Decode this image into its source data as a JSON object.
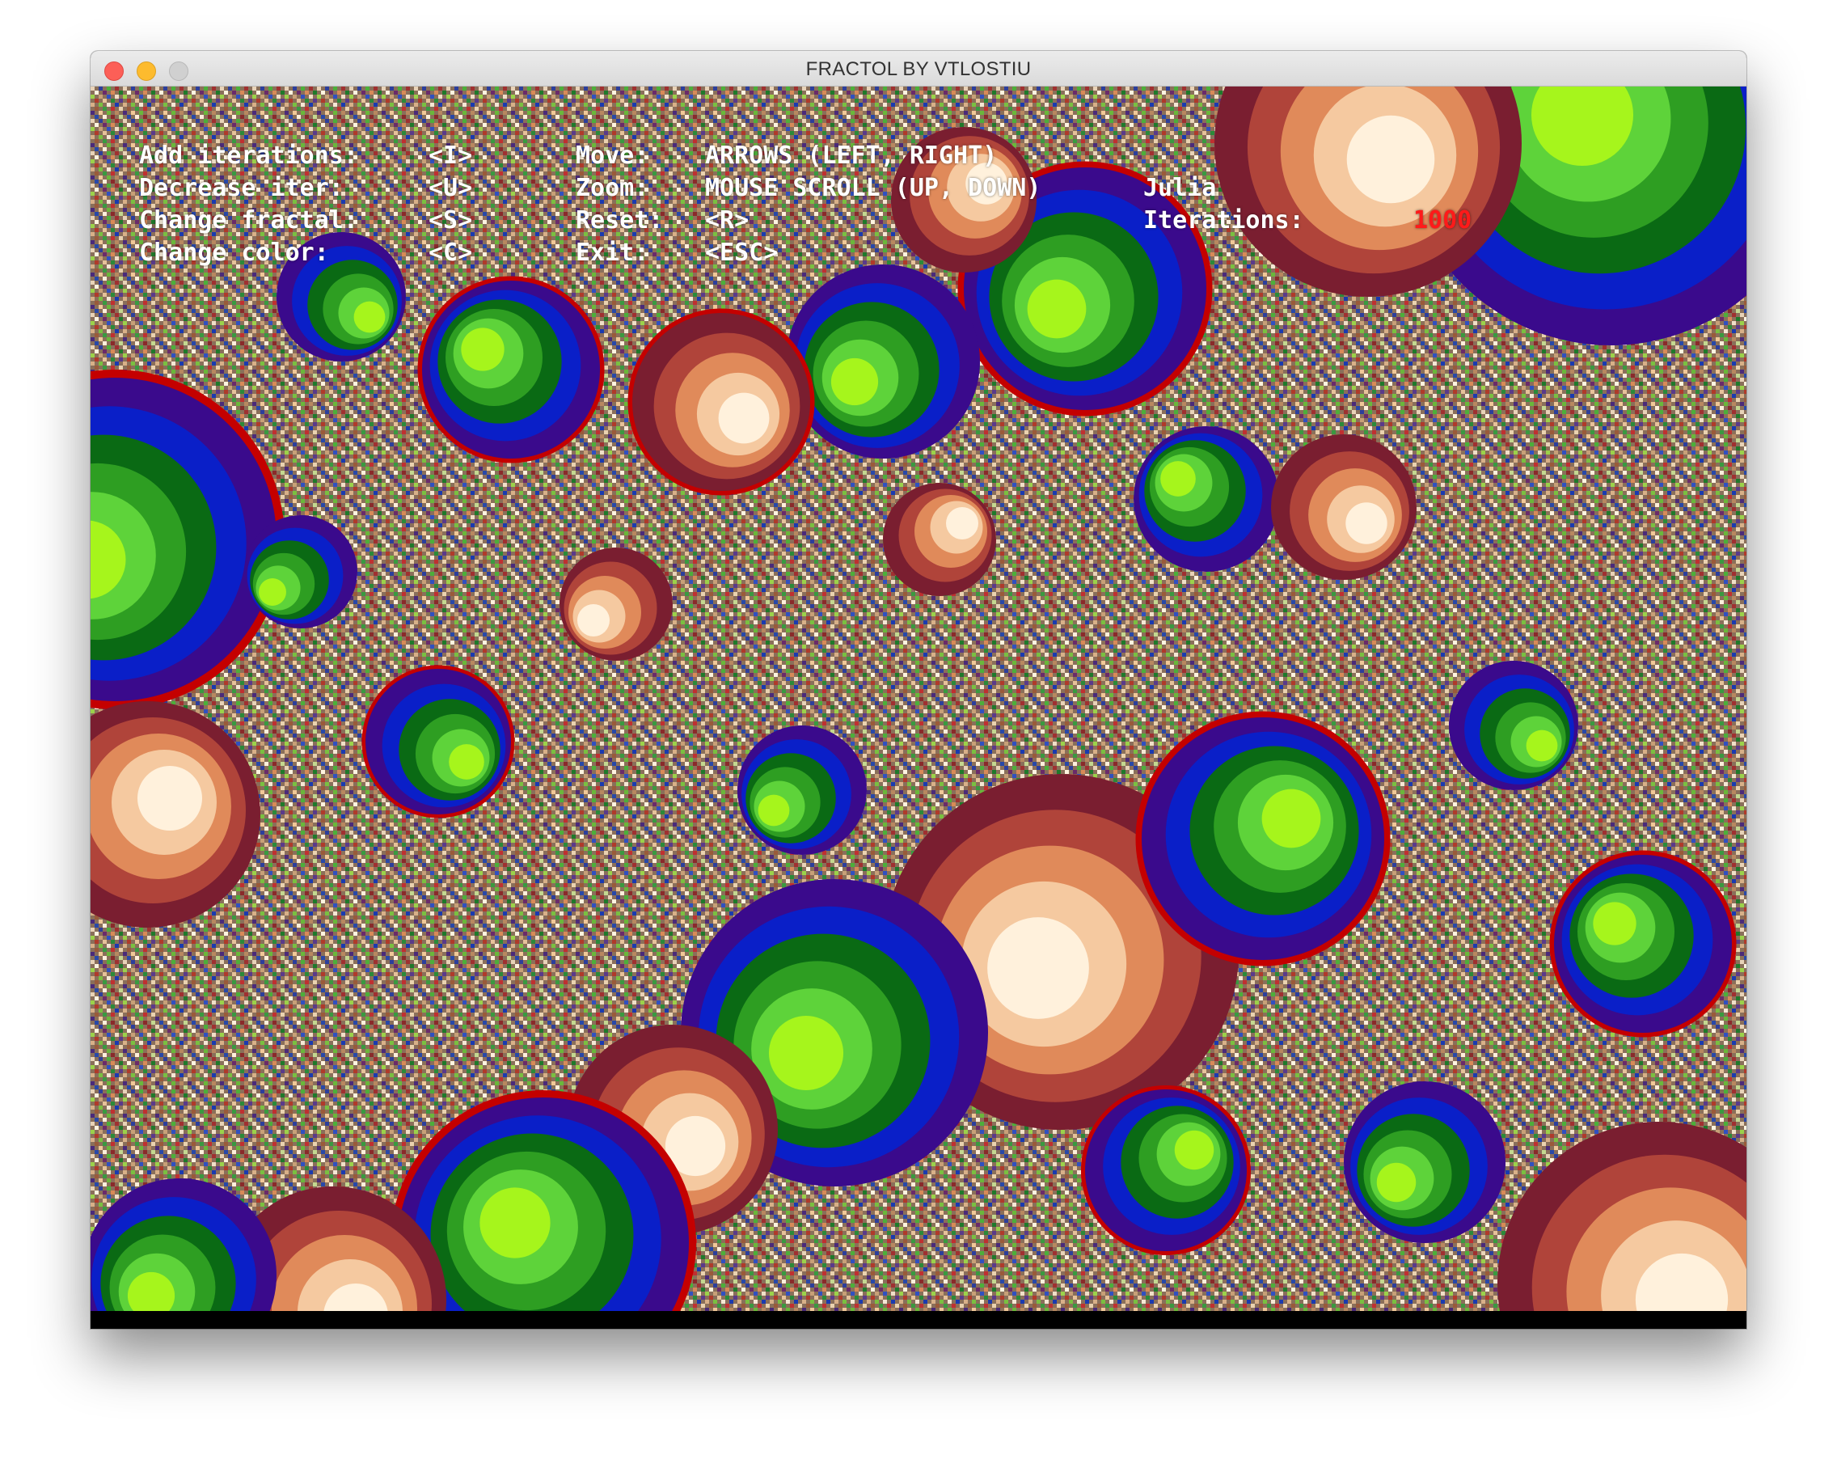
{
  "window": {
    "title": "FRACTOL BY VTLOSTIU"
  },
  "hud": {
    "controls_left": [
      {
        "label": "Add iterations:",
        "key": "<I>"
      },
      {
        "label": "Decrease iter:",
        "key": "<U>"
      },
      {
        "label": "Change fractal:",
        "key": "<S>"
      },
      {
        "label": "Change color:",
        "key": "<C>"
      }
    ],
    "controls_middle": [
      {
        "label": "Move:",
        "key": "ARROWS (LEFT, RIGHT)"
      },
      {
        "label": "Zoom:",
        "key": "MOUSE SCROLL (UP, DOWN)"
      },
      {
        "label": "Reset:",
        "key": "<R>"
      },
      {
        "label": "Exit:",
        "key": "<ESC>"
      }
    ],
    "fractal_name": "Julia",
    "iterations_label": "Iterations:",
    "iterations_value": "1000"
  },
  "colors": {
    "hud_text": "#ffffff",
    "iterations_value": "#ff1a1a",
    "palette": [
      "#0a1fc8",
      "#3a0a8c",
      "#7a1e30",
      "#b0443a",
      "#e08a5a",
      "#f5c9a0",
      "#fff1dc",
      "#c40000",
      "#0a6a14",
      "#2e9e22",
      "#5ed33a",
      "#a6f51c"
    ]
  }
}
